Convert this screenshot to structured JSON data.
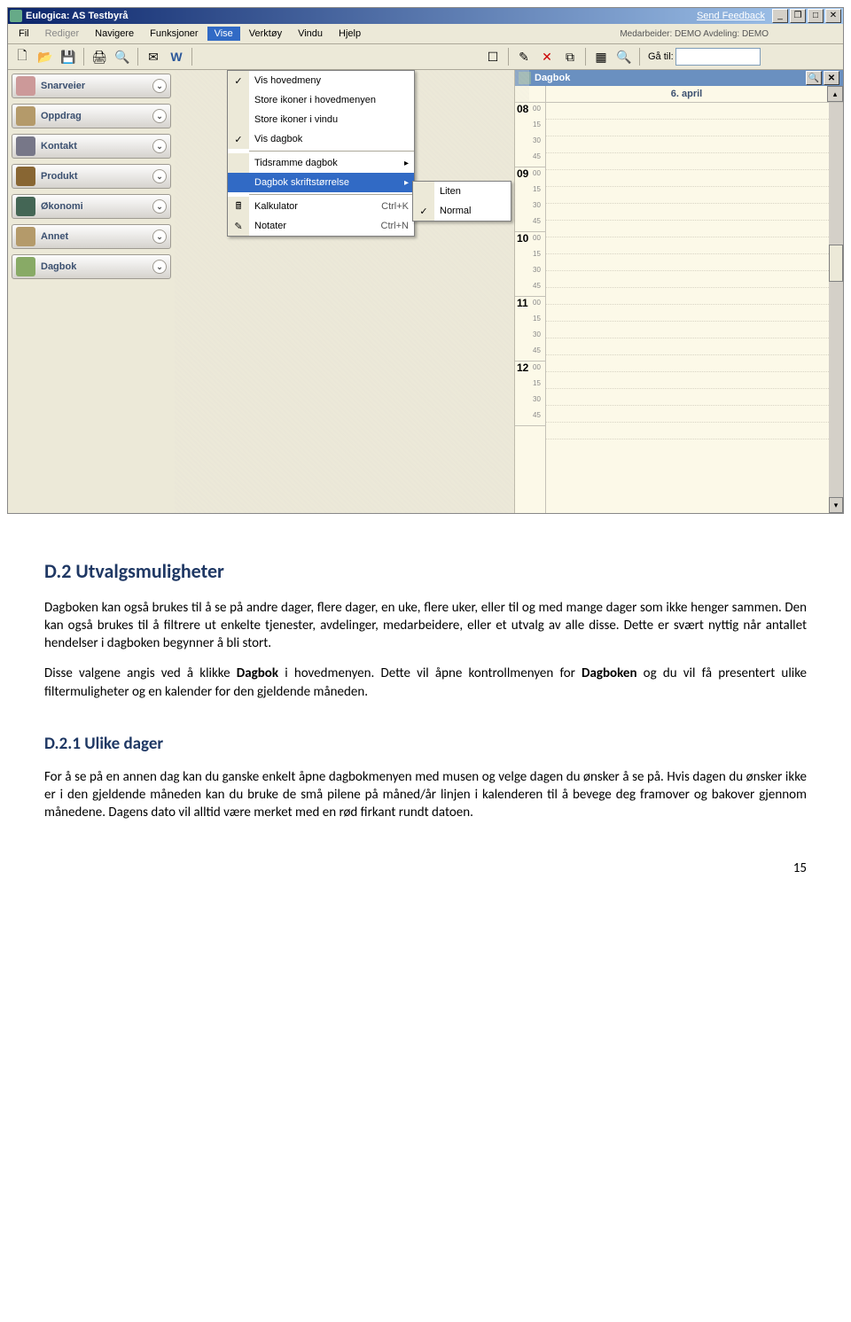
{
  "titlebar": {
    "title": "Eulogica: AS Testbyrå",
    "feedback": "Send Feedback"
  },
  "menubar": {
    "items": [
      "Fil",
      "Rediger",
      "Navigere",
      "Funksjoner",
      "Vise",
      "Verktøy",
      "Vindu",
      "Hjelp"
    ],
    "rightinfo": "Medarbeider: DEMO  Avdeling: DEMO"
  },
  "toolbar": {
    "goto_label": "Gå til:"
  },
  "sidebar": {
    "items": [
      {
        "label": "Snarveier"
      },
      {
        "label": "Oppdrag"
      },
      {
        "label": "Kontakt"
      },
      {
        "label": "Produkt"
      },
      {
        "label": "Økonomi"
      },
      {
        "label": "Annet"
      },
      {
        "label": "Dagbok"
      }
    ]
  },
  "vise_menu": {
    "items": [
      {
        "label": "Vis hovedmeny",
        "checked": true
      },
      {
        "label": "Store ikoner i hovedmenyen"
      },
      {
        "label": "Store ikoner i vindu"
      },
      {
        "label": "Vis dagbok",
        "checked": true,
        "sep_after": true
      },
      {
        "label": "Tidsramme dagbok",
        "submenu": true
      },
      {
        "label": "Dagbok skriftstørrelse",
        "submenu": true,
        "highlight": true,
        "sep_after": true
      },
      {
        "label": "Kalkulator",
        "shortcut": "Ctrl+K",
        "icon": "calc"
      },
      {
        "label": "Notater",
        "shortcut": "Ctrl+N",
        "icon": "note"
      }
    ]
  },
  "submenu": {
    "items": [
      {
        "label": "Liten"
      },
      {
        "label": "Normal",
        "checked": true
      }
    ]
  },
  "dagbok": {
    "title": "Dagbok",
    "date": "6. april",
    "hours": [
      "08",
      "09",
      "10",
      "11",
      "12"
    ],
    "subs": [
      "00",
      "15",
      "30",
      "45"
    ]
  },
  "doc": {
    "h2": "D.2  Utvalgsmuligheter",
    "p1": "Dagboken kan også brukes til å se på andre dager, flere dager, en uke, flere uker, eller til og med mange dager som ikke henger sammen.  Den kan også brukes til å filtrere ut enkelte tjenester, avdelinger, medarbeidere, eller et utvalg av alle disse.  Dette er svært nyttig når antallet hendelser i dagboken begynner å bli stort.",
    "p2a": "Disse valgene angis ved å klikke ",
    "p2b": "Dagbok",
    "p2c": " i hovedmenyen.  Dette vil åpne kontrollmenyen for ",
    "p2d": "Dagboken",
    "p2e": " og du vil få presentert ulike filtermuligheter og en kalender for den gjeldende måneden.",
    "h3": "D.2.1 Ulike dager",
    "p3": "For å se på en annen dag kan du ganske enkelt åpne dagbokmenyen med musen og velge dagen du ønsker å se på.  Hvis dagen du ønsker ikke er i den gjeldende måneden kan du bruke de små pilene på måned/år linjen i kalenderen til å bevege deg framover og bakover gjennom månedene.  Dagens dato vil alltid være merket med en rød firkant rundt datoen.",
    "pagenum": "15"
  }
}
